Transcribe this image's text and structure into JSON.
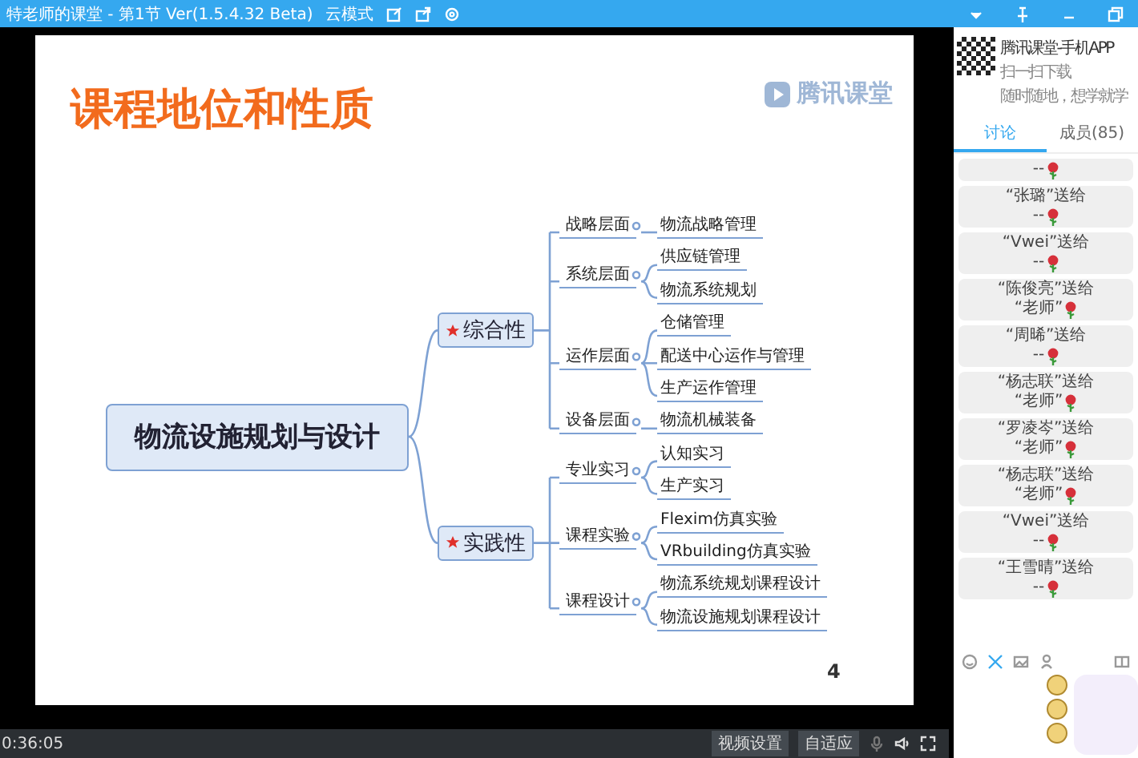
{
  "window": {
    "title": "特老师的课堂 - 第1节 Ver(1.5.4.32 Beta)",
    "mode": "云模式"
  },
  "slide": {
    "title": "课程地位和性质",
    "logo": "腾讯课堂",
    "page": "4",
    "mindmap": {
      "label": "物流设施规划与设计",
      "children": [
        {
          "label": "综合性",
          "starred": true,
          "children": [
            {
              "label": "战略层面",
              "children": [
                {
                  "label": "物流战略管理"
                }
              ]
            },
            {
              "label": "系统层面",
              "children": [
                {
                  "label": "供应链管理"
                },
                {
                  "label": "物流系统规划"
                }
              ]
            },
            {
              "label": "运作层面",
              "children": [
                {
                  "label": "仓储管理"
                },
                {
                  "label": "配送中心运作与管理"
                },
                {
                  "label": "生产运作管理"
                }
              ]
            },
            {
              "label": "设备层面",
              "children": [
                {
                  "label": "物流机械装备"
                }
              ]
            }
          ]
        },
        {
          "label": "实践性",
          "starred": true,
          "children": [
            {
              "label": "专业实习",
              "children": [
                {
                  "label": "认知实习"
                },
                {
                  "label": "生产实习"
                }
              ]
            },
            {
              "label": "课程实验",
              "children": [
                {
                  "label": "Flexim仿真实验"
                },
                {
                  "label": "VRbuilding仿真实验"
                }
              ]
            },
            {
              "label": "课程设计",
              "children": [
                {
                  "label": "物流系统规划课程设计"
                },
                {
                  "label": "物流设施规划课程设计"
                }
              ]
            }
          ]
        }
      ]
    }
  },
  "player": {
    "time": "0:36:05",
    "buttons": [
      "视频设置",
      "自适应"
    ]
  },
  "side": {
    "app_title": "腾讯课堂-手机APP",
    "app_line1": "扫一扫下载",
    "app_line2": "随时随地，想学就学",
    "tabs": [
      {
        "label": "讨论",
        "selected": true
      },
      {
        "label": "成员(85)",
        "selected": false
      }
    ],
    "messages": [
      {
        "line2": "--"
      },
      {
        "sender": "“张璐”送给",
        "line2": "--"
      },
      {
        "sender": "“Vwei”送给",
        "line2": "--"
      },
      {
        "sender": "“陈俊亮”送给",
        "line2": "“老师”"
      },
      {
        "sender": "“周晞”送给",
        "line2": "--"
      },
      {
        "sender": "“杨志联”送给",
        "line2": "“老师”"
      },
      {
        "sender": "“罗凌岑”送给",
        "line2": "“老师”"
      },
      {
        "sender": "“杨志联”送给",
        "line2": "“老师”"
      },
      {
        "sender": "“Vwei”送给",
        "line2": "--"
      },
      {
        "sender": "“王雪晴”送给",
        "line2": "--"
      }
    ]
  }
}
